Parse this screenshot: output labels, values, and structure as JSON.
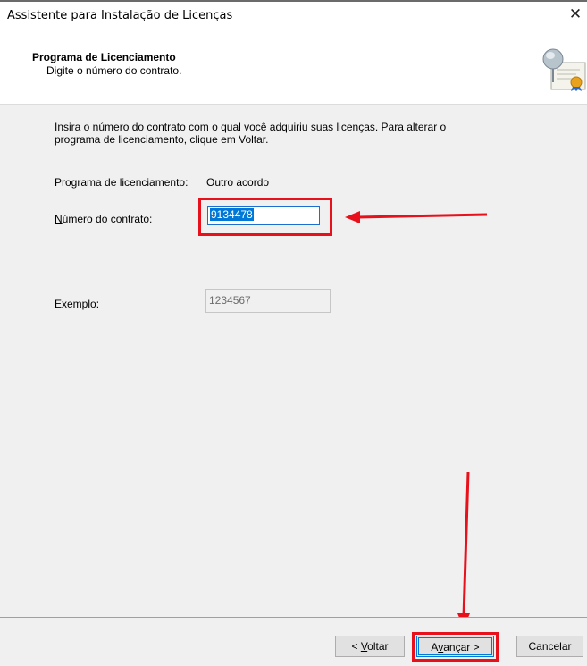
{
  "window": {
    "title": "Assistente para Instalação de Licenças",
    "close_glyph": "✕"
  },
  "header": {
    "title": "Programa de Licenciamento",
    "subtitle": "Digite o número do contrato.",
    "icon": "certificate-icon"
  },
  "content": {
    "intro_line1": "Insira o número do contrato com o qual você adquiriu suas licenças. Para alterar o",
    "intro_line2": "programa de licenciamento, clique em Voltar.",
    "program_label": "Programa de licenciamento:",
    "program_value": "Outro acordo",
    "contract_label_accel": "N",
    "contract_label_rest": "úmero do contrato:",
    "contract_value": "9134478",
    "example_label": "Exemplo:",
    "example_value": "1234567"
  },
  "footer": {
    "back_prefix": "< ",
    "back_accel": "V",
    "back_rest": "oltar",
    "next_prefix": "A",
    "next_accel": "v",
    "next_rest": "ançar >",
    "cancel_label": "Cancelar"
  },
  "colors": {
    "highlight": "#e8111b",
    "selection": "#0078d7",
    "panel": "#f0f0f0"
  }
}
